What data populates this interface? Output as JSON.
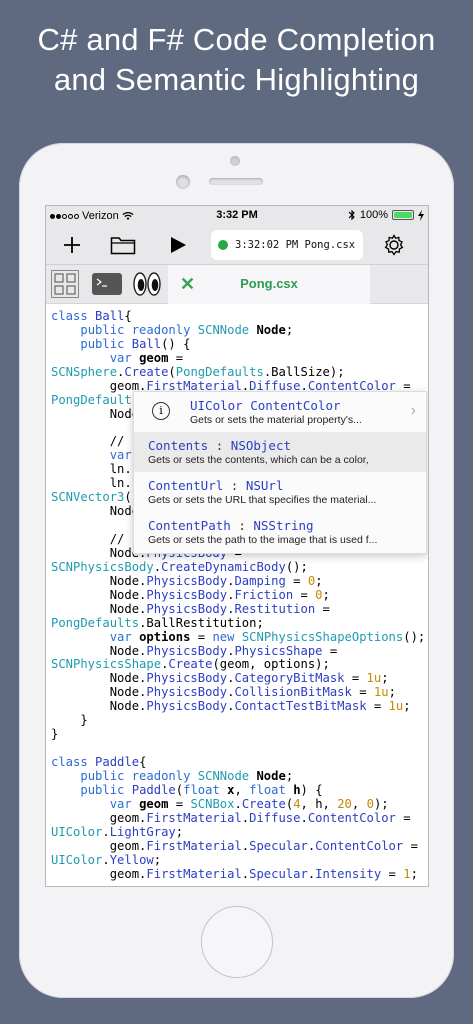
{
  "headline": {
    "line1": "C# and F# Code Completion",
    "line2": "and Semantic Highlighting"
  },
  "status_bar": {
    "carrier": "Verizon",
    "time": "3:32 PM",
    "battery": "100%",
    "battery_level": 1.0,
    "icons": [
      "signal-dots-icon",
      "wifi-icon",
      "bluetooth-icon",
      "battery-icon",
      "charging-icon"
    ]
  },
  "toolbar": {
    "status_text": "3:32:02 PM Pong.csx r",
    "status_color": "#28a745",
    "icons": [
      "plus-icon",
      "folder-icon",
      "play-icon",
      "gear-icon"
    ]
  },
  "tabs": {
    "active_label": "Pong.csx",
    "accent_color": "#2f9e4f",
    "icons": [
      "grid-icon",
      "terminal-icon",
      "eyes-icon",
      "close-icon"
    ]
  },
  "code_lines": [
    [
      [
        "kw",
        "class "
      ],
      [
        "me",
        "Ball"
      ],
      [
        "",
        "{"
      ]
    ],
    [
      [
        "",
        "    "
      ],
      [
        "kw",
        "public readonly "
      ],
      [
        "ty",
        "SCNNode "
      ],
      [
        "bold",
        "Node"
      ],
      [
        "",
        ";"
      ]
    ],
    [
      [
        "",
        "    "
      ],
      [
        "kw",
        "public "
      ],
      [
        "me",
        "Ball"
      ],
      [
        "",
        "() {"
      ]
    ],
    [
      [
        "",
        "        "
      ],
      [
        "kw",
        "var "
      ],
      [
        "bold",
        "geom"
      ],
      [
        "",
        " ="
      ]
    ],
    [
      [
        "ty",
        "SCNSphere"
      ],
      [
        "",
        "."
      ],
      [
        "me",
        "Create"
      ],
      [
        "",
        "("
      ],
      [
        "ty",
        "PongDefaults"
      ],
      [
        "",
        ".BallSize);"
      ]
    ],
    [
      [
        "",
        "        geom."
      ],
      [
        "me",
        "FirstMaterial"
      ],
      [
        "",
        "."
      ],
      [
        "me",
        "Diffuse"
      ],
      [
        "",
        "."
      ],
      [
        "me",
        "ContentColor"
      ],
      [
        "",
        " ="
      ]
    ],
    [
      [
        "ty",
        "PongDefaults"
      ],
      [
        "",
        "."
      ]
    ],
    [
      [
        "",
        "        Node"
      ]
    ],
    [
      [
        "",
        ""
      ]
    ],
    [
      [
        "",
        "        // "
      ]
    ],
    [
      [
        "",
        "        "
      ],
      [
        "kw",
        "var"
      ]
    ],
    [
      [
        "",
        "        ln.I"
      ]
    ],
    [
      [
        "",
        "        ln.I"
      ]
    ],
    [
      [
        "ty",
        "SCNVector3"
      ],
      [
        "",
        "("
      ]
    ],
    [
      [
        "",
        "        Node"
      ]
    ],
    [
      [
        "",
        ""
      ]
    ],
    [
      [
        "",
        "        // "
      ]
    ],
    [
      [
        "",
        "        Node."
      ],
      [
        "me",
        "PhysicsBody"
      ],
      [
        "",
        " ="
      ]
    ],
    [
      [
        "ty",
        "SCNPhysicsBody"
      ],
      [
        "",
        "."
      ],
      [
        "me",
        "CreateDynamicBody"
      ],
      [
        "",
        "();"
      ]
    ],
    [
      [
        "",
        "        Node."
      ],
      [
        "me",
        "PhysicsBody"
      ],
      [
        "",
        "."
      ],
      [
        "me",
        "Damping"
      ],
      [
        "",
        " = "
      ],
      [
        "nu",
        "0"
      ],
      [
        "",
        ";"
      ]
    ],
    [
      [
        "",
        "        Node."
      ],
      [
        "me",
        "PhysicsBody"
      ],
      [
        "",
        "."
      ],
      [
        "me",
        "Friction"
      ],
      [
        "",
        " = "
      ],
      [
        "nu",
        "0"
      ],
      [
        "",
        ";"
      ]
    ],
    [
      [
        "",
        "        Node."
      ],
      [
        "me",
        "PhysicsBody"
      ],
      [
        "",
        "."
      ],
      [
        "me",
        "Restitution"
      ],
      [
        "",
        " ="
      ]
    ],
    [
      [
        "ty",
        "PongDefaults"
      ],
      [
        "",
        ".BallRestitution;"
      ]
    ],
    [
      [
        "",
        "        "
      ],
      [
        "kw",
        "var "
      ],
      [
        "bold",
        "options"
      ],
      [
        "",
        " = "
      ],
      [
        "kw",
        "new "
      ],
      [
        "ty",
        "SCNPhysicsShapeOptions"
      ],
      [
        "",
        "();"
      ]
    ],
    [
      [
        "",
        "        Node."
      ],
      [
        "me",
        "PhysicsBody"
      ],
      [
        "",
        "."
      ],
      [
        "me",
        "PhysicsShape"
      ],
      [
        "",
        " ="
      ]
    ],
    [
      [
        "ty",
        "SCNPhysicsShape"
      ],
      [
        "",
        "."
      ],
      [
        "me",
        "Create"
      ],
      [
        "",
        "(geom, options);"
      ]
    ],
    [
      [
        "",
        "        Node."
      ],
      [
        "me",
        "PhysicsBody"
      ],
      [
        "",
        "."
      ],
      [
        "me",
        "CategoryBitMask"
      ],
      [
        "",
        " = "
      ],
      [
        "nu",
        "1u"
      ],
      [
        "",
        ";"
      ]
    ],
    [
      [
        "",
        "        Node."
      ],
      [
        "me",
        "PhysicsBody"
      ],
      [
        "",
        "."
      ],
      [
        "me",
        "CollisionBitMask"
      ],
      [
        "",
        " = "
      ],
      [
        "nu",
        "1u"
      ],
      [
        "",
        ";"
      ]
    ],
    [
      [
        "",
        "        Node."
      ],
      [
        "me",
        "PhysicsBody"
      ],
      [
        "",
        "."
      ],
      [
        "me",
        "ContactTestBitMask"
      ],
      [
        "",
        " = "
      ],
      [
        "nu",
        "1u"
      ],
      [
        "",
        ";"
      ]
    ],
    [
      [
        "",
        "    }"
      ]
    ],
    [
      [
        "",
        "}"
      ]
    ],
    [
      [
        "",
        ""
      ]
    ],
    [
      [
        "kw",
        "class "
      ],
      [
        "me",
        "Paddle"
      ],
      [
        "",
        "{"
      ]
    ],
    [
      [
        "",
        "    "
      ],
      [
        "kw",
        "public readonly "
      ],
      [
        "ty",
        "SCNNode "
      ],
      [
        "bold",
        "Node"
      ],
      [
        "",
        ";"
      ]
    ],
    [
      [
        "",
        "    "
      ],
      [
        "kw",
        "public "
      ],
      [
        "me",
        "Paddle"
      ],
      [
        "",
        "("
      ],
      [
        "kw",
        "float "
      ],
      [
        "bold",
        "x"
      ],
      [
        "",
        ", "
      ],
      [
        "kw",
        "float "
      ],
      [
        "bold",
        "h"
      ],
      [
        "",
        ") {"
      ]
    ],
    [
      [
        "",
        "        "
      ],
      [
        "kw",
        "var "
      ],
      [
        "bold",
        "geom"
      ],
      [
        "",
        " = "
      ],
      [
        "ty",
        "SCNBox"
      ],
      [
        "",
        "."
      ],
      [
        "me",
        "Create"
      ],
      [
        "",
        "("
      ],
      [
        "nu",
        "4"
      ],
      [
        "",
        ", h, "
      ],
      [
        "nu",
        "20"
      ],
      [
        "",
        ", "
      ],
      [
        "nu",
        "0"
      ],
      [
        "",
        ");"
      ]
    ],
    [
      [
        "",
        "        geom."
      ],
      [
        "me",
        "FirstMaterial"
      ],
      [
        "",
        "."
      ],
      [
        "me",
        "Diffuse"
      ],
      [
        "",
        "."
      ],
      [
        "me",
        "ContentColor"
      ],
      [
        "",
        " ="
      ]
    ],
    [
      [
        "ty",
        "UIColor"
      ],
      [
        "",
        "."
      ],
      [
        "me",
        "LightGray"
      ],
      [
        "",
        ";"
      ]
    ],
    [
      [
        "",
        "        geom."
      ],
      [
        "me",
        "FirstMaterial"
      ],
      [
        "",
        "."
      ],
      [
        "me",
        "Specular"
      ],
      [
        "",
        "."
      ],
      [
        "me",
        "ContentColor"
      ],
      [
        "",
        " ="
      ]
    ],
    [
      [
        "ty",
        "UIColor"
      ],
      [
        "",
        "."
      ],
      [
        "me",
        "Yellow"
      ],
      [
        "",
        ";"
      ]
    ],
    [
      [
        "",
        "        geom."
      ],
      [
        "me",
        "FirstMaterial"
      ],
      [
        "",
        "."
      ],
      [
        "me",
        "Specular"
      ],
      [
        "",
        "."
      ],
      [
        "me",
        "Intensity"
      ],
      [
        "",
        " = "
      ],
      [
        "nu",
        "1"
      ],
      [
        "",
        ";"
      ]
    ]
  ],
  "completion_popup": {
    "items": [
      {
        "name": "UIColor ContentColor",
        "type": "",
        "desc": "Gets or sets the material property's...",
        "selected": false,
        "info": true
      },
      {
        "name": "Contents",
        "type": "NSObject",
        "desc": "Gets or sets the contents, which can be a color,",
        "selected": true,
        "info": false
      },
      {
        "name": "ContentUrl",
        "type": "NSUrl",
        "desc": "Gets or sets the URL that specifies the material...",
        "selected": false,
        "info": false
      },
      {
        "name": "ContentPath",
        "type": "NSString",
        "desc": "Gets or sets the path to the image that is used f...",
        "selected": false,
        "info": false
      }
    ]
  },
  "colors": {
    "keyword": "#2a6cd6",
    "type": "#1f9bb0",
    "member": "#2c3ec4",
    "number": "#c78a00"
  }
}
